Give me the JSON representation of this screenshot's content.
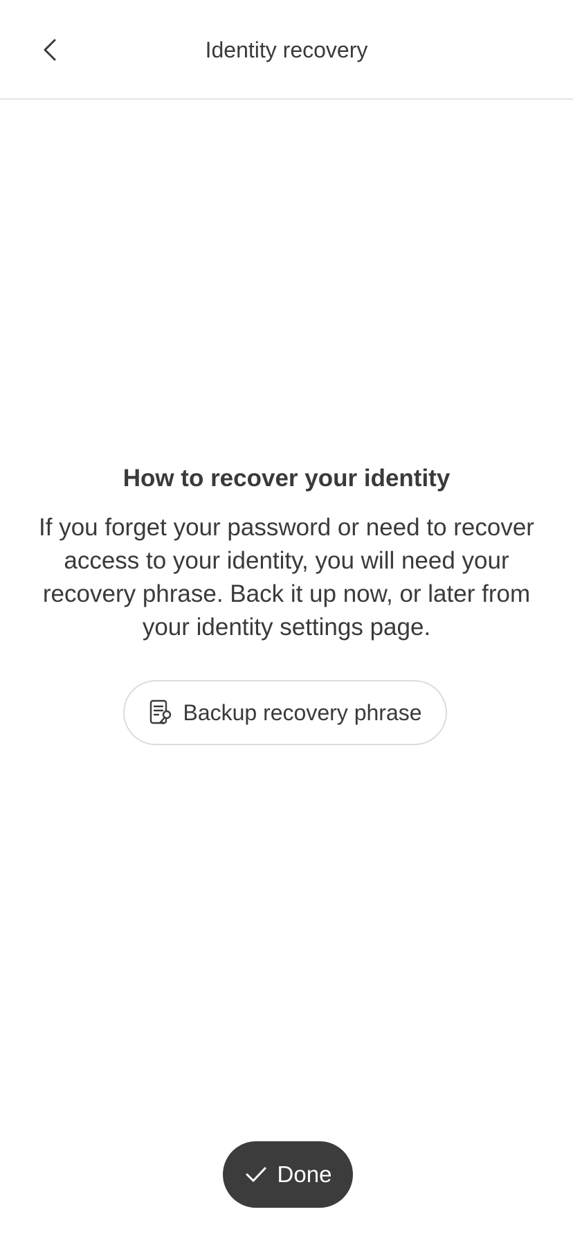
{
  "header": {
    "title": "Identity recovery",
    "back_icon": "chevron-left-icon"
  },
  "main": {
    "heading": "How to recover your identity",
    "body": "If you forget your password or need to recover access to your identity, you will need your recovery phrase. Back it up now, or later from your identity settings page.",
    "backup_button": {
      "label": "Backup recovery phrase",
      "icon": "document-key-icon"
    }
  },
  "footer": {
    "done_button": {
      "label": "Done",
      "icon": "checkmark-icon"
    }
  },
  "colors": {
    "text": "#3a3a3a",
    "done_background": "#3c3c3c",
    "done_text": "#ffffff",
    "divider": "#e4e4e4",
    "button_border": "#dcdcdc",
    "background": "#ffffff"
  }
}
